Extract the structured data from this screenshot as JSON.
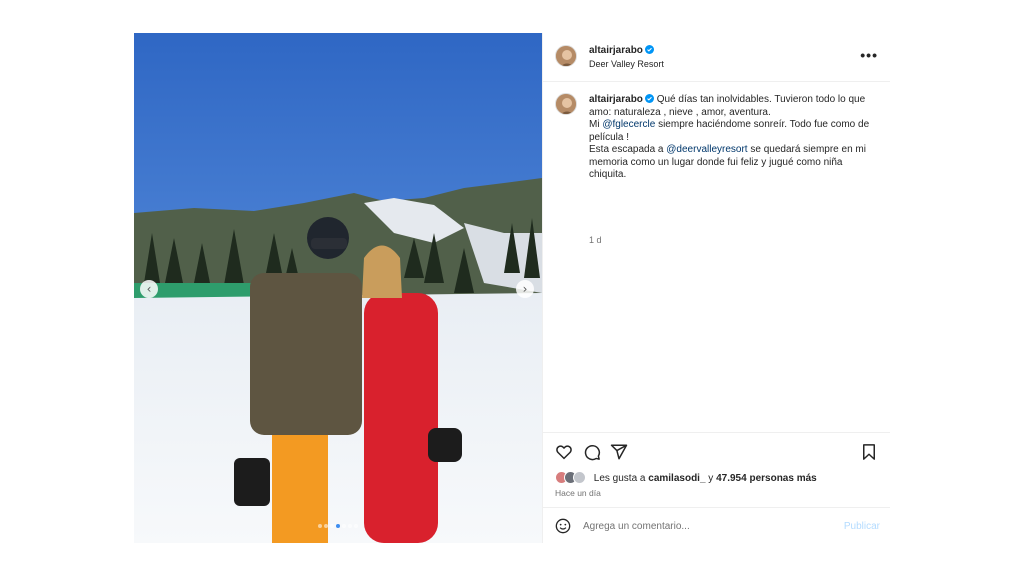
{
  "post": {
    "username": "altairjarabo",
    "location": "Deer Valley Resort",
    "more_label": "•••",
    "nav_prev": "‹",
    "nav_next": "›",
    "carousel": {
      "count": 7,
      "active_index": 3
    }
  },
  "caption": {
    "username": "altairjarabo",
    "line1": "Qué días tan inolvidables. Tuvieron todo lo que amo: naturaleza , nieve , amor, aventura.",
    "line2_prefix": "Mi ",
    "mention1": "@fglecercle",
    "line2_suffix": " siempre haciéndome sonreír. Todo fue como de película !",
    "line3_prefix": "Esta escapada a ",
    "mention2": "@deervalleyresort",
    "line3_suffix": " se quedará siempre en mi memoria como un lugar donde fui feliz y jugué como niña chiquita.",
    "time": "1 d"
  },
  "actions": {
    "like_icon": "heart-icon",
    "comment_icon": "comment-icon",
    "share_icon": "share-icon",
    "save_icon": "bookmark-icon"
  },
  "likes": {
    "prefix": "Les gusta a ",
    "user": "camilasodi_",
    "middle": " y ",
    "count": "47.954 personas más"
  },
  "posted": "Hace un día",
  "comment": {
    "placeholder": "Agrega un comentario...",
    "publish_label": "Publicar"
  },
  "colors": {
    "verified": "#0095f6",
    "mention": "#00376b",
    "publish_disabled": "#b3dbff",
    "muted": "#737373"
  }
}
